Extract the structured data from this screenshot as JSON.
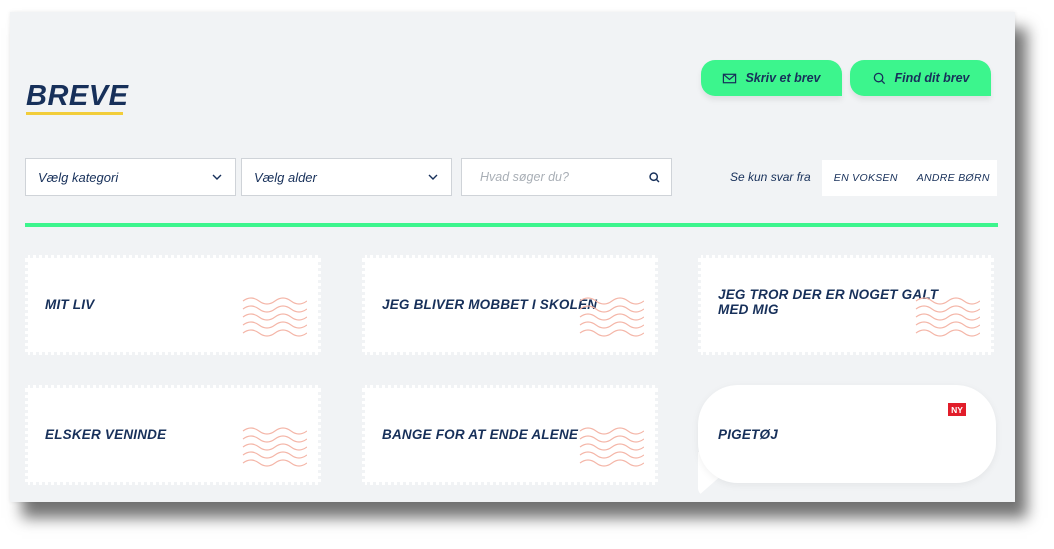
{
  "page": {
    "title": "BREVE"
  },
  "actions": {
    "write_label": "Skriv et brev",
    "find_label": "Find dit brev"
  },
  "filters": {
    "category_value": "Vælg kategori",
    "age_value": "Vælg alder",
    "search_placeholder": "Hvad søger du?",
    "reply_filter_label": "Se kun svar fra",
    "reply_options": [
      "EN VOKSEN",
      "ANDRE BØRN"
    ]
  },
  "cards": [
    {
      "title": "MIT LIV"
    },
    {
      "title": "JEG BLIVER MOBBET I SKOLEN"
    },
    {
      "title": "JEG TROR DER ER NOGET GALT MED MIG"
    },
    {
      "title": "ELSKER VENINDE"
    },
    {
      "title": "BANGE FOR AT ENDE ALENE"
    }
  ],
  "featured": {
    "title": "PIGETØJ",
    "badge": "NY"
  },
  "colors": {
    "accent": "#3cf58d",
    "navy": "#17305a",
    "title_underline": "#f2cd3a",
    "badge": "#e11d2a",
    "wavy_lines": "#f4b6a8",
    "background": "#f1f3f5"
  },
  "icons": {
    "write": "envelope-icon",
    "find": "search-icon",
    "dropdown": "chevron-down-icon",
    "search": "search-icon",
    "card_decoration": "wavy-postmark-icon"
  }
}
